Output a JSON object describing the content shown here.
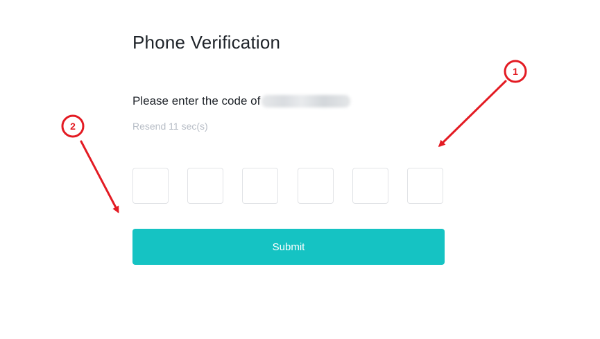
{
  "header": {
    "title": "Phone Verification"
  },
  "prompt": {
    "text": "Please enter the code of"
  },
  "resend": {
    "text": "Resend 11 sec(s)"
  },
  "code_inputs": {
    "count": 6,
    "values": [
      "",
      "",
      "",
      "",
      "",
      ""
    ]
  },
  "submit": {
    "label": "Submit"
  },
  "annotations": {
    "callout_1": "1",
    "callout_2": "2",
    "color": "#e31b23"
  },
  "colors": {
    "accent": "#15c3c3",
    "text": "#1e2329",
    "muted": "#b7bdc6",
    "border": "#e1e3e6"
  }
}
